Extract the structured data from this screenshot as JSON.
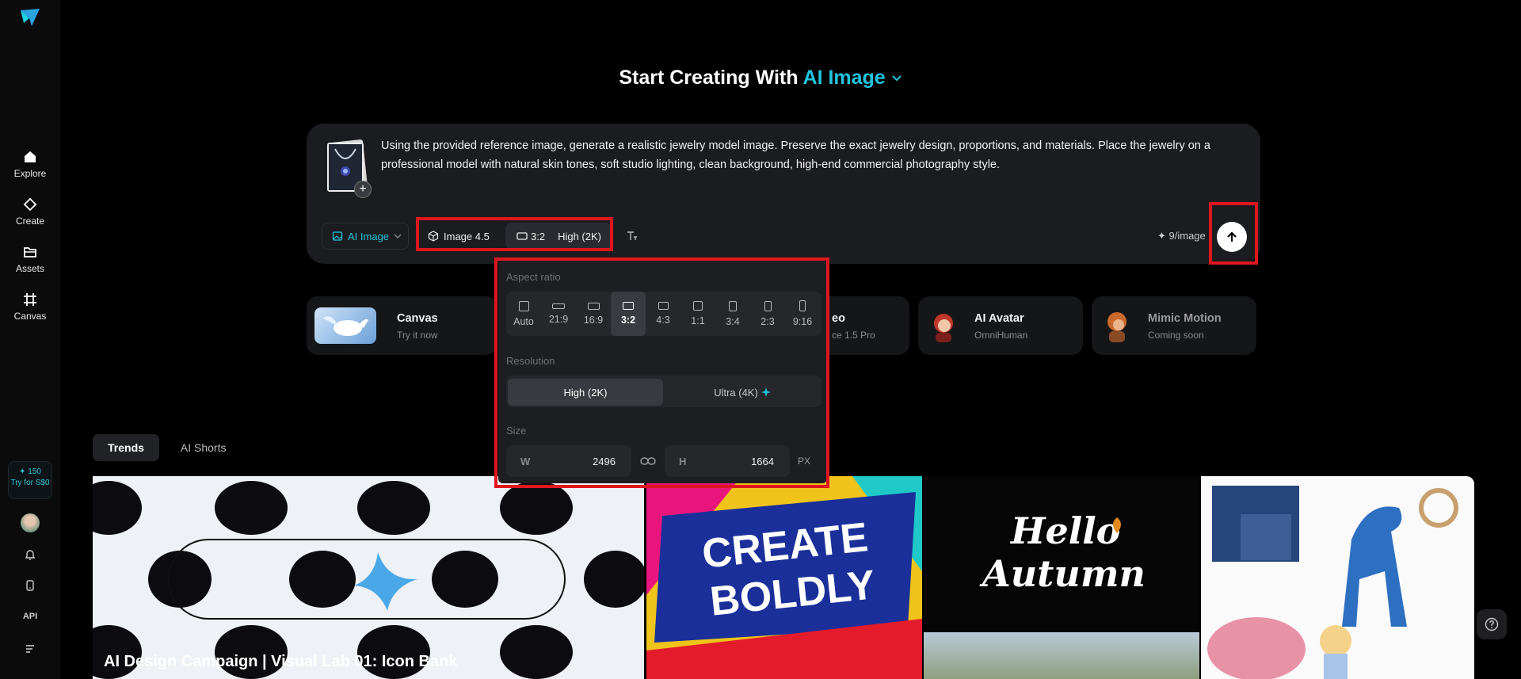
{
  "sidebar": {
    "items": [
      {
        "label": "Explore",
        "icon": "home-icon"
      },
      {
        "label": "Create",
        "icon": "diamond-icon"
      },
      {
        "label": "Assets",
        "icon": "folder-icon"
      },
      {
        "label": "Canvas",
        "icon": "canvas-grid-icon"
      }
    ],
    "credits": {
      "amount": "✦ 150",
      "cta": "Try for S$0"
    },
    "api_label": "API"
  },
  "headline": {
    "prefix": "Start Creating With",
    "mode": "AI Image"
  },
  "prompt": {
    "text": "Using the provided reference image, generate a realistic jewelry model image. Preserve the exact jewelry design, proportions, and materials. Place the jewelry on a professional model with natural skin tones, soft studio lighting, clean background, high-end commercial photography style."
  },
  "toolbar": {
    "mode_label": "AI Image",
    "model_label": "Image 4.5",
    "ratio_label": "3:2",
    "resolution_label": "High (2K)",
    "cost_label": "✦ 9/image"
  },
  "popup": {
    "aspect_title": "Aspect ratio",
    "ratios": [
      "Auto",
      "21:9",
      "16:9",
      "3:2",
      "4:3",
      "1:1",
      "3:4",
      "2:3",
      "9:16"
    ],
    "selected_ratio": "3:2",
    "resolution_title": "Resolution",
    "resolutions": [
      "High (2K)",
      "Ultra (4K)"
    ],
    "selected_resolution": "High (2K)",
    "size_title": "Size",
    "width_key": "W",
    "width": "2496",
    "height_key": "H",
    "height": "1664",
    "unit": "PX"
  },
  "feature_cards": [
    {
      "title": "Canvas",
      "subtitle": "Try it now"
    },
    {
      "title": "eo",
      "subtitle": "ce 1.5 Pro"
    },
    {
      "title": "AI Avatar",
      "subtitle": "OmniHuman"
    },
    {
      "title": "Mimic Motion",
      "subtitle": "Coming soon"
    }
  ],
  "tabs": [
    "Trends",
    "AI Shorts"
  ],
  "gallery": {
    "featured_caption": "AI Design Campaign | Visual Lab 01: Icon Bank",
    "poster_text": [
      "CREATE",
      "BOLDLY"
    ],
    "autumn_text": [
      "Hello",
      "Autumn"
    ]
  },
  "colors": {
    "accent": "#21c4dd",
    "highlight": "#e0161e",
    "background": "#000000"
  }
}
